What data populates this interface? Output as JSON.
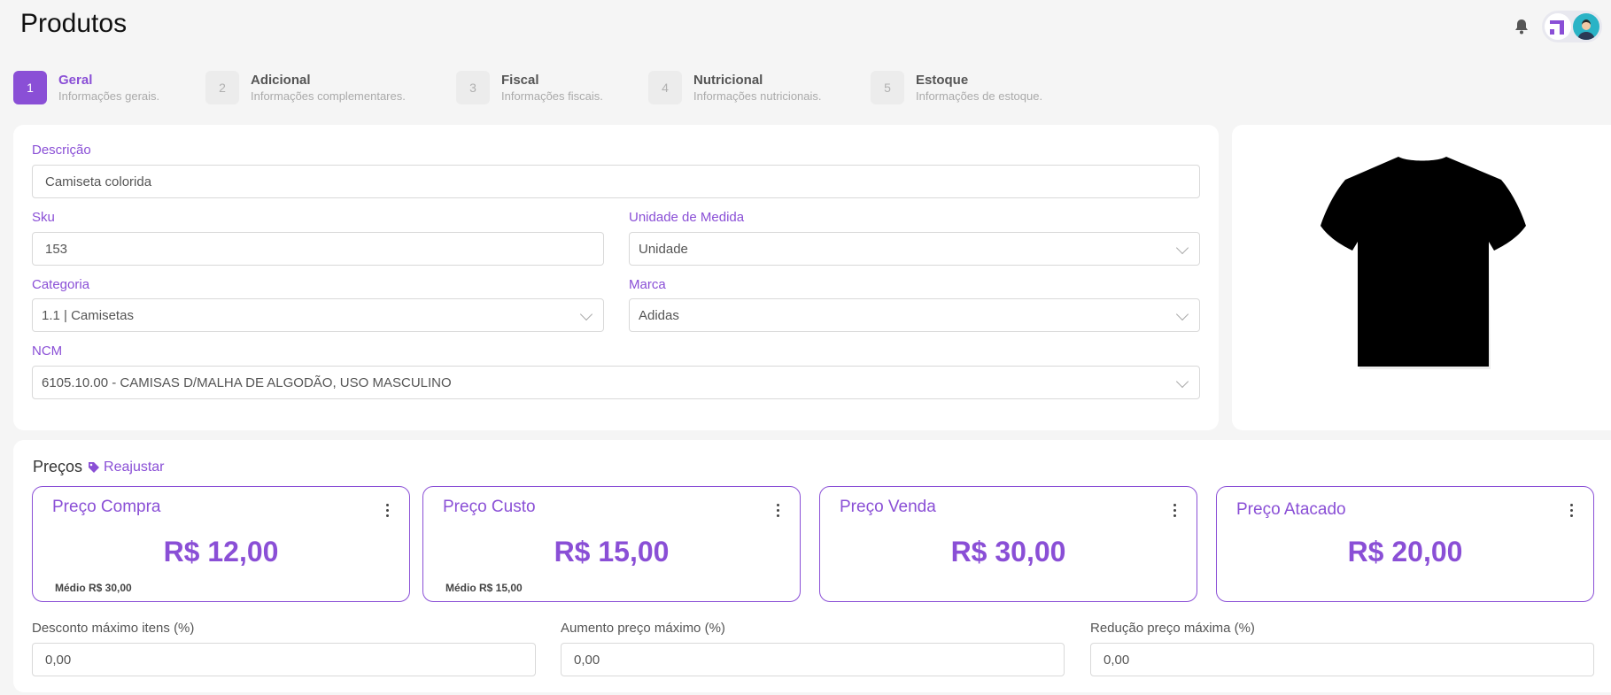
{
  "page": {
    "title": "Produtos"
  },
  "steps": [
    {
      "num": "1",
      "title": "Geral",
      "subtitle": "Informações gerais."
    },
    {
      "num": "2",
      "title": "Adicional",
      "subtitle": "Informações complementares."
    },
    {
      "num": "3",
      "title": "Fiscal",
      "subtitle": "Informações fiscais."
    },
    {
      "num": "4",
      "title": "Nutricional",
      "subtitle": "Informações nutricionais."
    },
    {
      "num": "5",
      "title": "Estoque",
      "subtitle": "Informações de estoque."
    }
  ],
  "form": {
    "descricao": {
      "label": "Descrição",
      "value": "Camiseta colorida"
    },
    "sku": {
      "label": "Sku",
      "value": "153"
    },
    "unidade": {
      "label": "Unidade de Medida",
      "value": "Unidade"
    },
    "categoria": {
      "label": "Categoria",
      "value": "1.1 | Camisetas"
    },
    "marca": {
      "label": "Marca",
      "value": "Adidas"
    },
    "ncm": {
      "label": "NCM",
      "value": "6105.10.00 - CAMISAS D/MALHA DE ALGODÃO, USO MASCULINO"
    }
  },
  "prices": {
    "title": "Preços",
    "reajustar": "Reajustar",
    "cards": [
      {
        "title": "Preço Compra",
        "value": "R$ 12,00",
        "medio": "Médio R$ 30,00"
      },
      {
        "title": "Preço Custo",
        "value": "R$ 15,00",
        "medio": "Médio R$ 15,00"
      },
      {
        "title": "Preço Venda",
        "value": "R$ 30,00",
        "medio": ""
      },
      {
        "title": "Preço Atacado",
        "value": "R$ 20,00",
        "medio": ""
      }
    ],
    "desconto": {
      "label": "Desconto máximo itens (%)",
      "value": "0,00"
    },
    "aumento": {
      "label": "Aumento preço máximo (%)",
      "value": "0,00"
    },
    "reducao": {
      "label": "Redução preço máxima (%)",
      "value": "0,00"
    }
  },
  "colors": {
    "accent": "#8a4fd6",
    "background": "#f5f5f5"
  },
  "icons": {
    "notification": "bell-icon",
    "tag": "tag-icon",
    "menu": "more-vertical-icon"
  }
}
